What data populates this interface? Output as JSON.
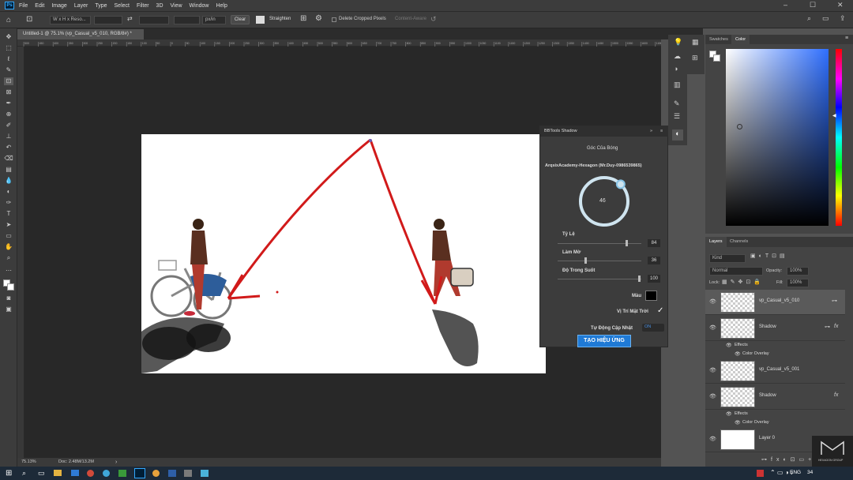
{
  "menu": {
    "app_icon": "Ps",
    "items": [
      "File",
      "Edit",
      "Image",
      "Layer",
      "Type",
      "Select",
      "Filter",
      "3D",
      "View",
      "Window",
      "Help"
    ],
    "win_controls": [
      "–",
      "☐",
      "✕"
    ]
  },
  "options": {
    "ratio": "W x H x Reso...",
    "unit": "px/in",
    "clear": "Clear",
    "straighten": "Straighten",
    "delete_cropped": "Delete Cropped Pixels",
    "content_aware": "Content-Aware"
  },
  "document": {
    "tab_title": "Untitled-1 @ 75.1% (vp_Casual_v5_010, RGB/8#) *"
  },
  "ruler_top": [
    "500",
    "450",
    "400",
    "350",
    "300",
    "250",
    "200",
    "150",
    "100",
    "50",
    "0",
    "50",
    "100",
    "150",
    "200",
    "250",
    "300",
    "350",
    "400",
    "450",
    "500",
    "550",
    "600",
    "650",
    "700",
    "750",
    "800",
    "850",
    "900",
    "950",
    "1000",
    "1050",
    "1100",
    "1150",
    "1200",
    "1250",
    "1300",
    "1350",
    "1400",
    "1450",
    "1500",
    "1550",
    "1600",
    "1650"
  ],
  "status": {
    "zoom": "75.13%",
    "doc": "Doc: 2.48M/13.2M"
  },
  "bbtools": {
    "title": "BBTools Shadow",
    "header_controls": "»",
    "section_title": "Góc Của Bóng",
    "author": "ArqsixAcademy-Hexagon (Mr.Duy-0986539865)",
    "angle": "46",
    "angle_value": 46,
    "scale_label": "Tỷ Lệ",
    "scale_value": "84",
    "blur_label": "Làm Mờ",
    "blur_value": "36",
    "opacity_label": "Độ Trong Suốt",
    "opacity_value": "100",
    "color_label": "Màu",
    "sun_label": "Vị Trí Mặt Trời",
    "auto_update_label": "Tự Động Cập Nhật",
    "auto_update_state": "ON",
    "action_button": "TẠO HIỆU ỨNG"
  },
  "color_panel": {
    "tabs": [
      "Swatches",
      "Color"
    ]
  },
  "layers_panel": {
    "tabs": [
      "Layers",
      "Channels"
    ],
    "filter": "Kind",
    "blend_mode": "Normal",
    "opacity_label": "Opacity:",
    "opacity_value": "100%",
    "lock_label": "Lock:",
    "fill_label": "Fill:",
    "fill_value": "100%",
    "layers": [
      {
        "name": "vp_Casual_v5_010"
      },
      {
        "name": "Shadow",
        "fx": "fx",
        "effects": "Effects",
        "effect": "Color Overlay"
      },
      {
        "name": "vp_Casual_v5_001"
      },
      {
        "name": "Shadow",
        "fx": "fx",
        "effects": "Effects",
        "effect": "Color Overlay"
      },
      {
        "name": "Layer 0"
      }
    ]
  },
  "taskbar": {
    "lang": "ENG",
    "clock": "34"
  },
  "logo": {
    "text": "HEXAGON GROUP"
  },
  "colors": {
    "accent": "#31a8ff",
    "arrow": "#d11a1a",
    "ring": "#cfe4ef",
    "action_button": "#1f7ad6"
  }
}
